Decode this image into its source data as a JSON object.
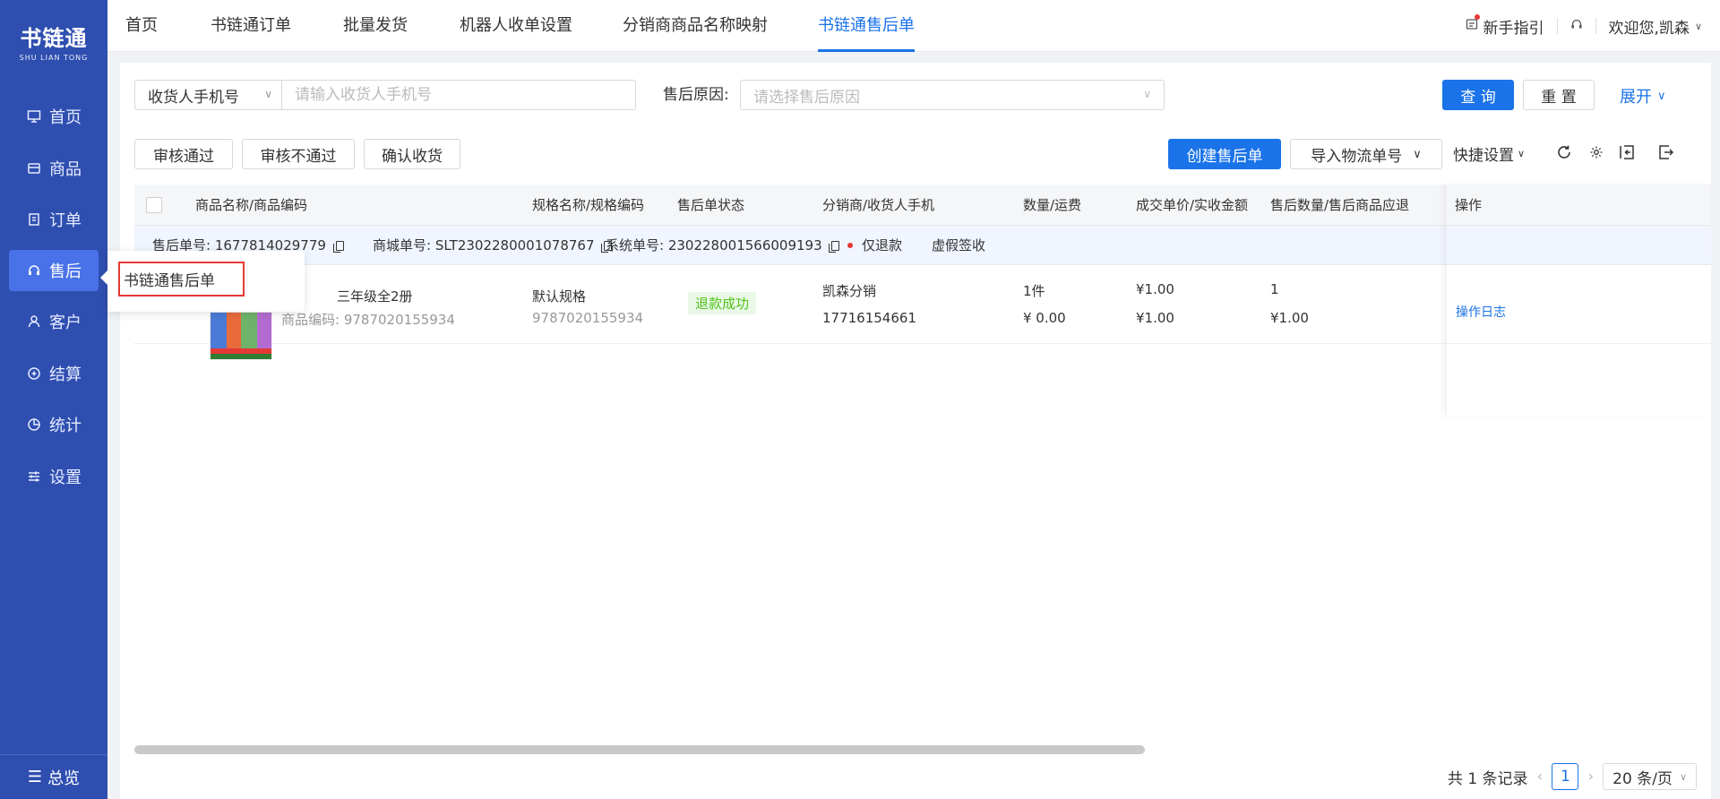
{
  "brand": {
    "name": "书链通",
    "sub": "SHU LIAN TONG"
  },
  "sidebar": {
    "items": [
      {
        "label": "首页",
        "icon": "monitor-icon"
      },
      {
        "label": "商品",
        "icon": "box-icon"
      },
      {
        "label": "订单",
        "icon": "order-icon"
      },
      {
        "label": "售后",
        "icon": "headset-icon"
      },
      {
        "label": "客户",
        "icon": "user-icon"
      },
      {
        "label": "结算",
        "icon": "settle-icon"
      },
      {
        "label": "统计",
        "icon": "pie-icon"
      },
      {
        "label": "设置",
        "icon": "sliders-icon"
      }
    ],
    "bottom_label": "总览"
  },
  "flyout": {
    "item": "书链通售后单"
  },
  "tabs": [
    "首页",
    "书链通订单",
    "批量发货",
    "机器人收单设置",
    "分销商商品名称映射",
    "书链通售后单"
  ],
  "header": {
    "guide": "新手指引",
    "welcome": "欢迎您,凯森"
  },
  "filters": {
    "select_label": "收货人手机号",
    "input_placeholder": "请输入收货人手机号",
    "reason_label": "售后原因:",
    "reason_placeholder": "请选择售后原因",
    "query": "查 询",
    "reset": "重 置",
    "expand": "展开"
  },
  "actions": {
    "approve": "审核通过",
    "reject": "审核不通过",
    "confirm_receipt": "确认收货",
    "create": "创建售后单",
    "import_logistics": "导入物流单号",
    "quick_settings": "快捷设置"
  },
  "table": {
    "headers": [
      "商品名称/商品编码",
      "规格名称/规格编码",
      "售后单状态",
      "分销商/收货人手机",
      "数量/运费",
      "成交单价/实收金额",
      "售后数量/售后商品应退",
      "操作"
    ],
    "group": {
      "after_sale_no_label": "售后单号:",
      "after_sale_no": "1677814029779",
      "mall_no_label": "商城单号:",
      "mall_no": "SLT2302280001078767",
      "system_no_label": "系统单号:",
      "system_no": "230228001566009193",
      "refund_type": "仅退款",
      "sign_status": "虚假签收"
    },
    "rows": [
      {
        "name": "三年级全2册",
        "code_label": "商品编码:",
        "code": "9787020155934",
        "spec": "默认规格",
        "spec_code": "9787020155934",
        "status": "退款成功",
        "distributor": "凯森分销",
        "phone": "17716154661",
        "qty": "1件",
        "freight": "¥ 0.00",
        "price": "¥1.00",
        "received": "¥1.00",
        "as_qty": "1",
        "as_refund": "¥1.00",
        "op": "操作日志"
      }
    ]
  },
  "pager": {
    "total": "共 1 条记录",
    "current": "1",
    "size": "20 条/页"
  },
  "colors": {
    "sidebar": "#2f4fb0",
    "sidebar_active": "#4a72e8",
    "primary": "#1a73e8",
    "success": "#52c41a",
    "danger": "#e53935"
  }
}
